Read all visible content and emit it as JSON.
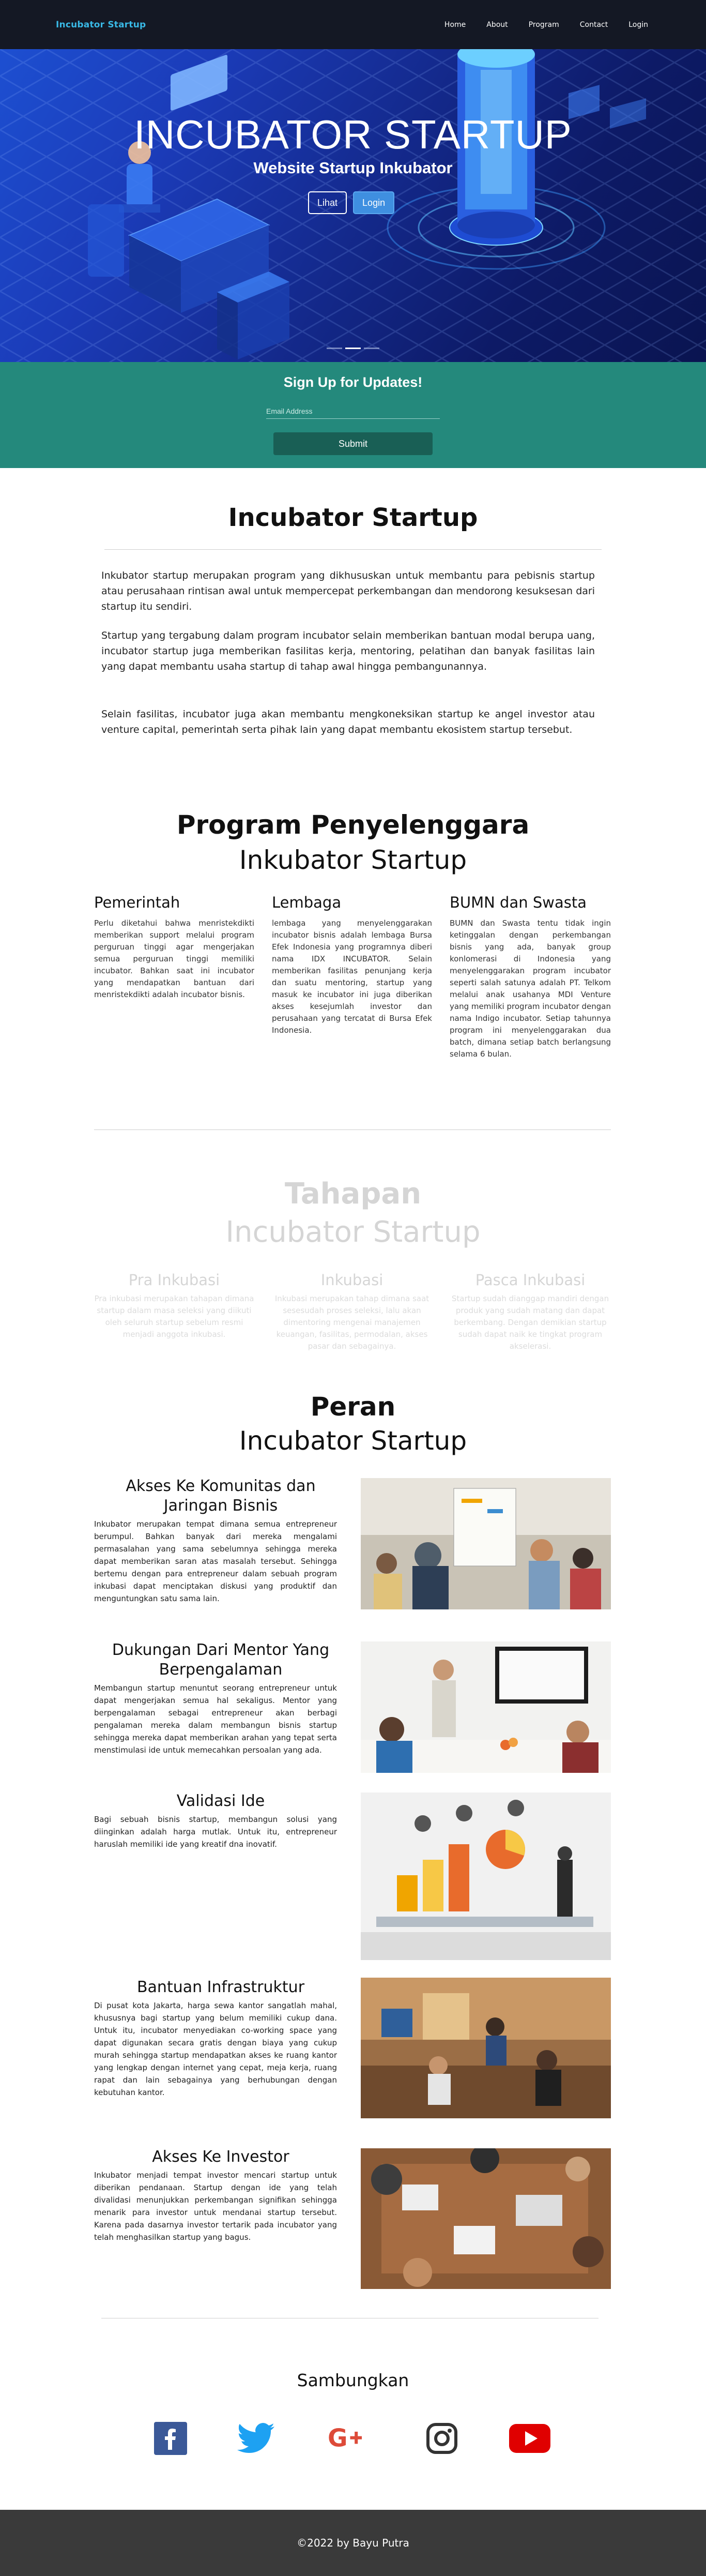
{
  "nav": {
    "brand": "Incubator Startup",
    "links": [
      "Home",
      "About",
      "Program",
      "Contact",
      "Login"
    ]
  },
  "hero": {
    "title": "INCUBATOR STARTUP",
    "subtitle": "Website Startup Inkubator",
    "button_view": "Lihat",
    "button_login": "Login",
    "slides": 3,
    "active_slide": 1
  },
  "signup": {
    "title": "Sign Up for Updates!",
    "placeholder": "Email Address",
    "button": "Submit"
  },
  "about": {
    "title": "Incubator Startup",
    "paragraphs": [
      "Inkubator startup merupakan program yang dikhususkan untuk membantu para pebisnis startup atau perusahaan rintisan awal untuk mempercepat perkembangan dan mendorong kesuksesan dari startup itu sendiri.",
      "Startup yang tergabung dalam program incubator selain memberikan bantuan modal berupa uang, incubator startup juga memberikan fasilitas kerja, mentoring, pelatihan dan banyak fasilitas lain yang dapat membantu usaha startup di tahap awal hingga pembangunannya.",
      "Selain fasilitas, incubator juga akan membantu mengkoneksikan startup ke angel investor atau venture capital, pemerintah serta pihak lain yang dapat membantu ekosistem startup tersebut."
    ]
  },
  "organizers": {
    "title_line1": "Program Penyelenggara",
    "title_line2": "Inkubator Startup",
    "columns": [
      {
        "heading": "Pemerintah",
        "text": "Perlu diketahui bahwa menristekdikti memberikan support melalui program perguruan tinggi agar mengerjakan semua perguruan tinggi memiliki incubator. Bahkan saat ini incubator yang mendapatkan bantuan dari menristekdikti adalah incubator bisnis."
      },
      {
        "heading": "Lembaga",
        "text": "lembaga yang menyelenggarakan incubator bisnis adalah lembaga Bursa Efek Indonesia yang programnya diberi nama IDX INCUBATOR. Selain memberikan fasilitas penunjang kerja dan suatu mentoring, startup yang masuk ke incubator ini juga diberikan akses kesejumlah investor dan perusahaan yang tercatat di Bursa Efek Indonesia."
      },
      {
        "heading": "BUMN dan Swasta",
        "text": "BUMN dan Swasta tentu tidak ingin ketinggalan dengan perkembangan bisnis yang ada, banyak group konlomerasi di Indonesia yang menyelenggarakan program incubator seperti salah satunya adalah PT. Telkom melalui anak usahanya MDI Venture yang memiliki program incubator dengan nama Indigo incubator. Setiap tahunnya program ini menyelenggarakan dua batch, dimana setiap batch berlangsung selama 6 bulan."
      }
    ]
  },
  "stages": {
    "title_line1": "Tahapan",
    "title_line2": "Incubator Startup",
    "columns": [
      {
        "heading": "Pra Inkubasi",
        "text": "Pra inkubasi merupakan tahapan dimana startup dalam masa seleksi yang diikuti oleh seluruh startup sebelum resmi menjadi anggota inkubasi."
      },
      {
        "heading": "Inkubasi",
        "text": "Inkubasi merupakan tahap dimana saat sesesudah proses seleksi, lalu akan dimentoring mengenai manajemen keuangan, fasilitas, permodalan, akses pasar dan sebagainya."
      },
      {
        "heading": "Pasca Inkubasi",
        "text": "Startup sudah dianggap mandiri dengan produk yang sudah matang dan dapat berkembang. Dengan demikian startup sudah dapat naik ke tingkat program akselerasi."
      }
    ]
  },
  "roles": {
    "title_line1": "Peran",
    "title_line2": "Incubator Startup",
    "items": [
      {
        "heading": "Akses Ke Komunitas dan Jaringan Bisnis",
        "text": "Inkubator merupakan tempat dimana semua entrepreneur berumpul. Bahkan banyak dari mereka mengalami permasalahan yang sama sebelumnya sehingga mereka dapat memberikan saran atas masalah tersebut. Sehingga bertemu dengan para entrepreneur dalam sebuah program inkubasi dapat menciptakan diskusi yang produktif dan menguntungkan satu sama lain."
      },
      {
        "heading": "Dukungan Dari Mentor Yang Berpengalaman",
        "text": "Membangun startup menuntut seorang entrepreneur untuk dapat mengerjakan semua hal sekaligus. Mentor yang berpengalaman sebagai entrepreneur akan berbagi pengalaman mereka dalam membangun bisnis startup sehingga mereka dapat memberikan arahan yang tepat serta menstimulasi ide untuk memecahkan persoalan yang ada."
      },
      {
        "heading": "Validasi Ide",
        "text": "Bagi sebuah bisnis startup, membangun solusi yang diinginkan adalah harga mutlak. Untuk itu, entrepreneur haruslah memiliki ide yang kreatif dna inovatif."
      },
      {
        "heading": "Bantuan Infrastruktur",
        "text": "Di pusat kota Jakarta, harga sewa kantor sangatlah mahal, khususnya bagi startup yang belum memiliki cukup dana. Untuk itu, incubator menyediakan co-working space yang dapat digunakan secara gratis dengan biaya yang cukup murah sehingga startup mendapatkan akses ke ruang kantor yang lengkap dengan internet yang cepat, meja kerja, ruang rapat dan lain sebagainya yang berhubungan dengan kebutuhan kantor."
      },
      {
        "heading": "Akses Ke Investor",
        "text": "Inkubator menjadi tempat investor mencari startup untuk diberikan pendanaan. Startup dengan ide yang telah divalidasi menunjukkan perkembangan signifikan sehingga menarik para investor untuk mendanai startup tersebut. Karena pada dasarnya investor tertarik pada incubator yang telah menghasilkan startup yang bagus."
      }
    ]
  },
  "connect": {
    "title": "Sambungkan",
    "icons": [
      "facebook-icon",
      "twitter-icon",
      "google-plus-icon",
      "instagram-icon",
      "youtube-icon"
    ],
    "colors": {
      "facebook": "#3b5998",
      "twitter": "#1da1f2",
      "google": "#dd4b39",
      "instagram": "#333333",
      "youtube": "#e00000"
    }
  },
  "footer": {
    "text": "©2022 by Bayu Putra"
  }
}
